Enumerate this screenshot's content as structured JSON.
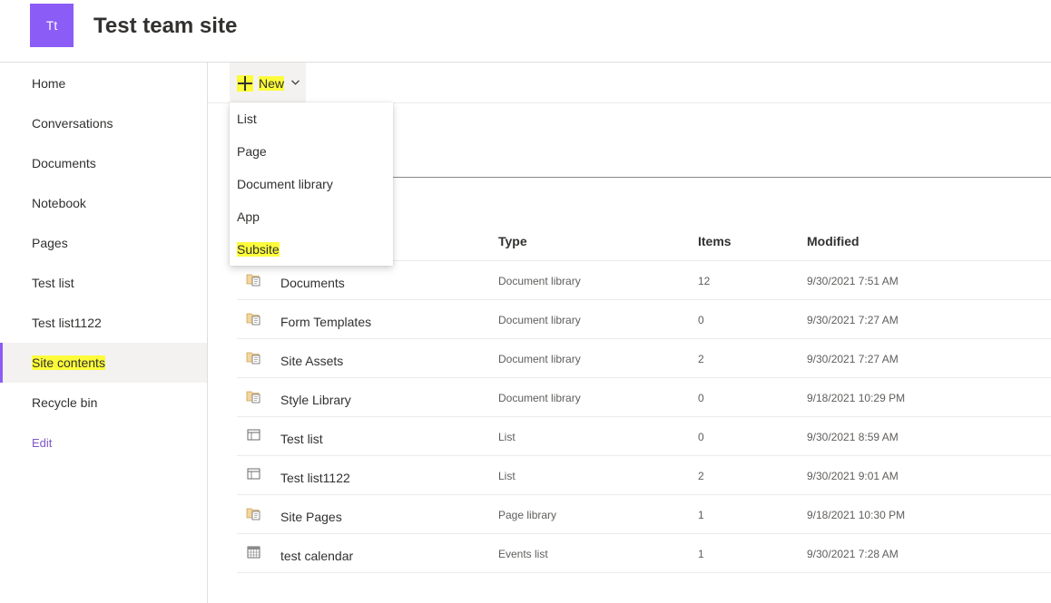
{
  "header": {
    "logo_initials": "Tt",
    "site_title": "Test team site",
    "logo_color": "#8b5cf6"
  },
  "leftnav": {
    "items": [
      {
        "label": "Home"
      },
      {
        "label": "Conversations"
      },
      {
        "label": "Documents"
      },
      {
        "label": "Notebook"
      },
      {
        "label": "Pages"
      },
      {
        "label": "Test list"
      },
      {
        "label": "Test list1122"
      },
      {
        "label": "Site contents",
        "selected": true,
        "highlighted": true
      },
      {
        "label": "Recycle bin"
      }
    ],
    "edit_label": "Edit"
  },
  "commandbar": {
    "new_label": "New",
    "new_icon": "plus-icon",
    "chevron_icon": "chevron-down-icon",
    "highlight_color": "#fcfc3b"
  },
  "new_menu": {
    "items": [
      {
        "label": "List"
      },
      {
        "label": "Page"
      },
      {
        "label": "Document library"
      },
      {
        "label": "App"
      },
      {
        "label": "Subsite",
        "highlighted": true
      }
    ]
  },
  "table": {
    "columns": {
      "type": "Type",
      "items": "Items",
      "modified": "Modified"
    },
    "rows": [
      {
        "icon": "document-library-icon",
        "name": "Documents",
        "type": "Document library",
        "items": "12",
        "modified": "9/30/2021 7:51 AM"
      },
      {
        "icon": "document-library-icon",
        "name": "Form Templates",
        "type": "Document library",
        "items": "0",
        "modified": "9/30/2021 7:27 AM"
      },
      {
        "icon": "document-library-icon",
        "name": "Site Assets",
        "type": "Document library",
        "items": "2",
        "modified": "9/30/2021 7:27 AM"
      },
      {
        "icon": "document-library-icon",
        "name": "Style Library",
        "type": "Document library",
        "items": "0",
        "modified": "9/18/2021 10:29 PM"
      },
      {
        "icon": "list-icon",
        "name": "Test list",
        "type": "List",
        "items": "0",
        "modified": "9/30/2021 8:59 AM"
      },
      {
        "icon": "list-icon",
        "name": "Test list1122",
        "type": "List",
        "items": "2",
        "modified": "9/30/2021 9:01 AM"
      },
      {
        "icon": "document-library-icon",
        "name": "Site Pages",
        "type": "Page library",
        "items": "1",
        "modified": "9/18/2021 10:30 PM"
      },
      {
        "icon": "calendar-icon",
        "name": "test calendar",
        "type": "Events list",
        "items": "1",
        "modified": "9/30/2021 7:28 AM"
      }
    ]
  }
}
